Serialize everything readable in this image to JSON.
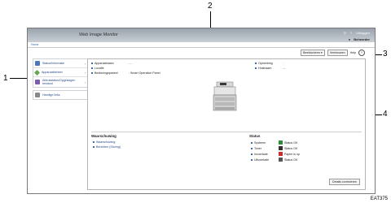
{
  "callouts": [
    "1",
    "2",
    "3",
    "4"
  ],
  "header": {
    "title": "Web Image Monitor",
    "utility_links": [
      "?",
      "Uitloggen"
    ],
    "user_label": "Beheerder"
  },
  "breadcrumb": "Home",
  "sidebar": {
    "groups": [
      {
        "label": "Status/Informatie",
        "icon": "info-icon"
      },
      {
        "label": "Apparaatbeheer",
        "icon": "device-icon"
      },
      {
        "label": "Afdrukstatus/Opgeslagen bestand",
        "icon": "job-icon"
      }
    ],
    "single_item": {
      "label": "Handige links",
      "icon": "link-icon"
    }
  },
  "toolbar": {
    "view_select": "Beeldscherm",
    "refresh_button": "Vernieuwen",
    "help_link": "Help"
  },
  "device": {
    "left_fields": [
      {
        "label": "Apparaatnaam",
        "value": "—"
      },
      {
        "label": "Locatie",
        "value": ""
      },
      {
        "label": "Bedieningspaneel",
        "value": ": Smart Operation Panel"
      }
    ],
    "right_fields": [
      {
        "label": "Opmerking",
        "value": ":"
      },
      {
        "label": "Hostnaam",
        "value": "—"
      }
    ]
  },
  "messages": {
    "title": "Waarschuwing",
    "items": [
      "Waarschuwing",
      "Berichten (Storing)"
    ]
  },
  "status": {
    "title": "Status",
    "rows": [
      {
        "label": "Systeem",
        "value": "Status OK",
        "color": "#2e8b3a"
      },
      {
        "label": "Toner",
        "value": "Status OK",
        "color": "#333333"
      },
      {
        "label": "Invoerlade",
        "value": "Papier is op",
        "color": "#d12a2a"
      },
      {
        "label": "Uitvoerlade",
        "value": "Status OK",
        "color": "#333333"
      }
    ]
  },
  "detail_button": "Details controleren",
  "figure_code": "EAT375"
}
